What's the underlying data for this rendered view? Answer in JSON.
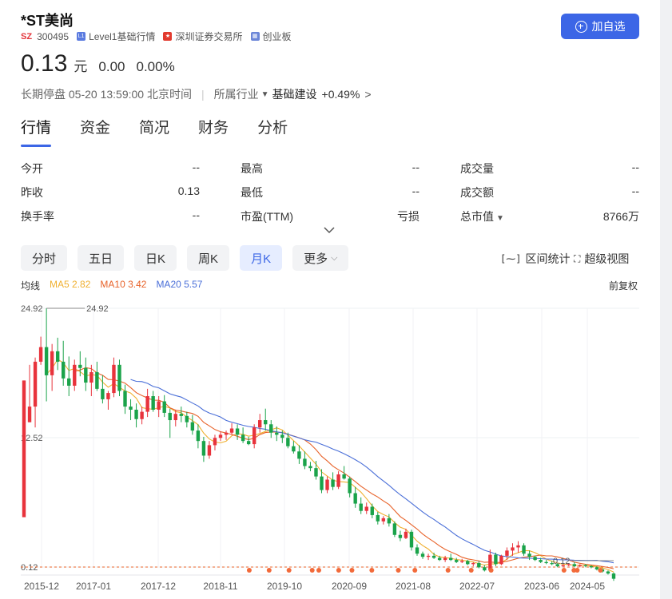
{
  "stock": {
    "name": "*ST美尚",
    "market": "SZ",
    "code": "300495",
    "quote_level": "Level1基础行情",
    "exchange": "深圳证券交易所",
    "board": "创业板"
  },
  "actions": {
    "add_watchlist": "加自选"
  },
  "quote": {
    "price": "0.13",
    "unit": "元",
    "change": "0.00",
    "change_pct": "0.00%"
  },
  "status": {
    "text": "长期停盘 05-20 13:59:00 北京时间",
    "industry_label": "所属行业",
    "industry": "基础建设",
    "industry_change": "+0.49%"
  },
  "tabs": [
    "行情",
    "资金",
    "简况",
    "财务",
    "分析"
  ],
  "stats": [
    [
      {
        "label": "今开",
        "value": "--"
      },
      {
        "label": "最高",
        "value": "--"
      },
      {
        "label": "成交量",
        "value": "--"
      }
    ],
    [
      {
        "label": "昨收",
        "value": "0.13"
      },
      {
        "label": "最低",
        "value": "--"
      },
      {
        "label": "成交额",
        "value": "--"
      }
    ],
    [
      {
        "label": "换手率",
        "value": "--"
      },
      {
        "label": "市盈(TTM)",
        "value": "亏损"
      },
      {
        "label": "总市值",
        "value": "8766万"
      }
    ]
  ],
  "periods": [
    "分时",
    "五日",
    "日K",
    "周K",
    "月K",
    "更多"
  ],
  "active_period": "月K",
  "tools": {
    "interval_stats": "区间统计",
    "super_view": "超级视图"
  },
  "ma": {
    "label": "均线",
    "ma5": "MA5 2.82",
    "ma10": "MA10 3.42",
    "ma20": "MA20 5.57",
    "adjust": "前复权"
  },
  "colors": {
    "up": "#e8333c",
    "down": "#1aa34a",
    "ma5": "#f0b030",
    "ma10": "#e8632a",
    "ma20": "#4a6fd8",
    "accent": "#3c66e6"
  },
  "chart_data": {
    "type": "candlestick",
    "y_ticks": [
      "24.92",
      "12.52",
      "0.12"
    ],
    "x_ticks": [
      "2015-12",
      "2017-01",
      "2017-12",
      "2018-11",
      "2019-10",
      "2020-09",
      "2021-08",
      "2022-07",
      "2023-06",
      "2024-05"
    ],
    "ylim": [
      0.12,
      24.92
    ],
    "max_label": "24.92",
    "min_label": "0.12",
    "ohlc": [
      [
        4.9,
        18.0,
        4.9,
        18.0
      ],
      [
        14.0,
        19.5,
        14.0,
        15.5
      ],
      [
        15.5,
        20.2,
        13.5,
        19.8
      ],
      [
        19.8,
        22.2,
        19.5,
        21.2
      ],
      [
        21.2,
        24.92,
        16.0,
        18.5
      ],
      [
        18.5,
        21.5,
        17.0,
        20.8
      ],
      [
        20.8,
        22.1,
        19.0,
        19.8
      ],
      [
        19.8,
        21.8,
        17.5,
        18.2
      ],
      [
        18.2,
        20.3,
        16.5,
        17.5
      ],
      [
        17.5,
        20.0,
        17.0,
        19.5
      ],
      [
        19.5,
        20.8,
        18.4,
        19.2
      ],
      [
        19.2,
        20.2,
        17.0,
        17.8
      ],
      [
        17.8,
        19.5,
        16.5,
        18.8
      ],
      [
        18.8,
        19.8,
        17.0,
        17.2
      ],
      [
        17.2,
        18.5,
        15.8,
        16.2
      ],
      [
        16.2,
        17.0,
        15.2,
        16.8
      ],
      [
        16.8,
        20.2,
        16.4,
        19.5
      ],
      [
        19.5,
        20.0,
        16.5,
        17.0
      ],
      [
        17.0,
        17.6,
        14.8,
        15.5
      ],
      [
        15.5,
        16.2,
        14.2,
        15.2
      ],
      [
        15.2,
        15.8,
        13.5,
        14.3
      ],
      [
        14.3,
        15.5,
        13.8,
        15.0
      ],
      [
        15.0,
        17.2,
        14.5,
        16.5
      ],
      [
        16.5,
        17.0,
        15.0,
        15.2
      ],
      [
        15.2,
        16.5,
        14.5,
        16.0
      ],
      [
        16.0,
        16.6,
        14.5,
        14.9
      ],
      [
        14.9,
        15.3,
        12.5,
        14.2
      ],
      [
        14.2,
        15.2,
        13.6,
        14.8
      ],
      [
        14.8,
        15.5,
        14.0,
        14.6
      ],
      [
        14.6,
        15.0,
        13.5,
        14.0
      ],
      [
        14.0,
        14.7,
        12.8,
        13.2
      ],
      [
        13.2,
        13.8,
        11.5,
        12.2
      ],
      [
        12.2,
        12.6,
        10.2,
        10.8
      ],
      [
        10.8,
        12.2,
        10.5,
        11.8
      ],
      [
        11.8,
        12.8,
        11.3,
        12.5
      ],
      [
        12.5,
        13.1,
        12.2,
        12.8
      ],
      [
        12.8,
        13.2,
        12.3,
        13.0
      ],
      [
        13.0,
        13.9,
        12.8,
        13.4
      ],
      [
        13.4,
        13.8,
        12.3,
        12.8
      ],
      [
        12.8,
        13.5,
        12.0,
        12.2
      ],
      [
        12.2,
        12.6,
        11.8,
        11.9
      ],
      [
        11.9,
        13.8,
        11.5,
        13.5
      ],
      [
        13.5,
        14.8,
        13.0,
        14.2
      ],
      [
        14.2,
        15.3,
        13.2,
        13.8
      ],
      [
        13.8,
        14.2,
        12.5,
        13.0
      ],
      [
        13.0,
        13.6,
        12.2,
        12.8
      ],
      [
        12.8,
        13.2,
        12.0,
        12.5
      ],
      [
        12.5,
        13.0,
        11.5,
        11.7
      ],
      [
        11.7,
        12.2,
        11.0,
        11.2
      ],
      [
        11.2,
        11.8,
        10.0,
        10.5
      ],
      [
        10.5,
        11.2,
        9.5,
        9.8
      ],
      [
        9.8,
        10.2,
        9.3,
        9.6
      ],
      [
        9.6,
        10.3,
        8.5,
        8.8
      ],
      [
        8.8,
        9.5,
        7.2,
        7.5
      ],
      [
        7.5,
        8.8,
        7.2,
        8.5
      ],
      [
        8.5,
        9.2,
        7.5,
        7.8
      ],
      [
        7.8,
        9.3,
        7.6,
        9.0
      ],
      [
        9.0,
        9.8,
        8.5,
        8.6
      ],
      [
        8.6,
        8.8,
        6.8,
        7.2
      ],
      [
        7.2,
        7.8,
        5.8,
        6.2
      ],
      [
        6.2,
        6.8,
        5.2,
        5.5
      ],
      [
        5.5,
        6.3,
        5.2,
        5.9
      ],
      [
        5.9,
        6.2,
        4.8,
        5.1
      ],
      [
        5.1,
        5.4,
        4.2,
        4.5
      ],
      [
        4.5,
        5.0,
        4.2,
        4.8
      ],
      [
        4.8,
        5.2,
        4.0,
        4.3
      ],
      [
        4.3,
        4.5,
        3.0,
        3.2
      ],
      [
        3.2,
        3.6,
        2.6,
        2.9
      ],
      [
        2.9,
        3.8,
        2.8,
        3.5
      ],
      [
        3.5,
        3.7,
        1.7,
        2.0
      ],
      [
        2.0,
        2.3,
        1.2,
        1.4
      ],
      [
        1.4,
        1.6,
        0.9,
        1.1
      ],
      [
        1.1,
        1.4,
        0.8,
        1.2
      ],
      [
        1.2,
        1.5,
        0.9,
        1.0
      ],
      [
        1.0,
        1.2,
        0.7,
        0.8
      ],
      [
        0.8,
        1.2,
        0.6,
        1.0
      ],
      [
        1.0,
        1.4,
        0.7,
        0.8
      ],
      [
        0.8,
        1.0,
        0.5,
        0.6
      ],
      [
        0.6,
        0.9,
        0.5,
        0.7
      ],
      [
        0.7,
        0.8,
        0.3,
        0.4
      ],
      [
        0.4,
        0.6,
        0.2,
        0.5
      ],
      [
        0.5,
        0.7,
        0.0,
        0.1
      ],
      [
        0.1,
        0.3,
        -0.3,
        -0.2
      ],
      [
        -0.2,
        1.8,
        -0.2,
        1.3
      ],
      [
        1.3,
        1.5,
        0.2,
        0.4
      ],
      [
        0.4,
        1.3,
        0.3,
        1.2
      ],
      [
        1.2,
        2.0,
        0.8,
        1.7
      ],
      [
        1.7,
        2.4,
        1.2,
        2.0
      ],
      [
        2.0,
        2.6,
        1.5,
        2.2
      ],
      [
        2.2,
        2.4,
        1.2,
        1.4
      ],
      [
        1.4,
        1.7,
        0.8,
        1.1
      ],
      [
        1.1,
        1.2,
        0.7,
        0.8
      ],
      [
        0.8,
        1.0,
        0.5,
        0.6
      ],
      [
        0.6,
        0.8,
        0.4,
        0.5
      ],
      [
        0.5,
        0.7,
        0.3,
        0.4
      ],
      [
        0.4,
        0.5,
        0.1,
        0.2
      ],
      [
        0.2,
        0.4,
        0.1,
        0.3
      ],
      [
        0.3,
        0.5,
        0.2,
        0.4
      ],
      [
        0.4,
        0.6,
        0.1,
        0.2
      ],
      [
        0.2,
        0.4,
        0.1,
        0.3
      ],
      [
        0.3,
        0.4,
        0.1,
        0.2
      ],
      [
        0.2,
        0.3,
        0.0,
        0.1
      ],
      [
        0.1,
        0.2,
        -0.2,
        -0.1
      ],
      [
        -0.1,
        0.0,
        -0.4,
        -0.3
      ],
      [
        -0.3,
        -0.2,
        -0.6,
        -0.5
      ],
      [
        -0.5,
        -0.4,
        -1.2,
        -1.0
      ]
    ],
    "ma_period_lengths": [
      5,
      10,
      20
    ],
    "events": [
      0.68,
      0.74,
      0.8,
      0.87,
      0.89,
      0.95,
      0.99,
      1.05,
      1.13,
      1.18,
      1.28,
      1.35,
      1.41,
      1.63,
      1.66,
      1.67,
      1.74
    ]
  }
}
